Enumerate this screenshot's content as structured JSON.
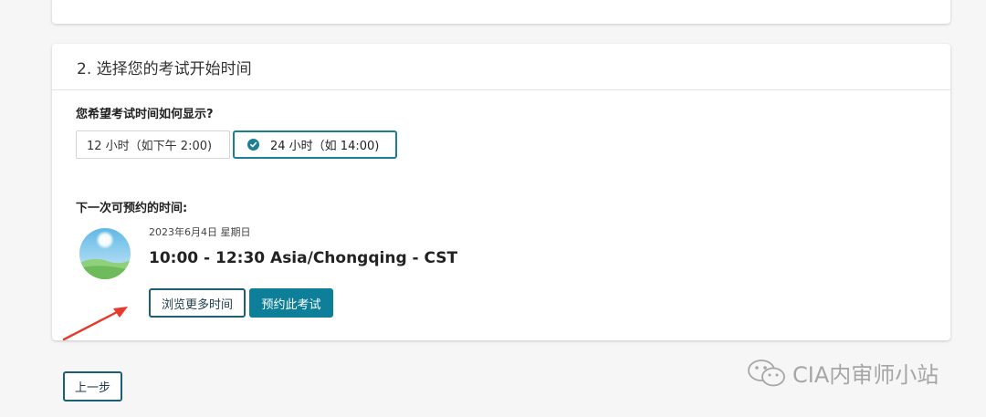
{
  "section": {
    "title": "2. 选择您的考试开始时间"
  },
  "time_format": {
    "question": "您希望考试时间如何显示?",
    "option_12h": "12 小时（如下午 2:00)",
    "option_24h": "24 小时（如 14:00)",
    "selected": "24h",
    "accent_color": "#1b7f96"
  },
  "next_slot": {
    "label": "下一次可预约的时间:",
    "date": "2023年6月4日 星期日",
    "time": "10:00 - 12:30 Asia/Chongqing - CST",
    "browse_label": "浏览更多时间",
    "book_label": "预约此考试",
    "avatar_icon": "sky-landscape-icon"
  },
  "nav": {
    "prev_label": "上一步"
  },
  "watermark": {
    "icon": "wechat-icon",
    "text": "CIA内审师小站"
  },
  "annotation": {
    "icon": "red-arrow-icon",
    "color": "#e8392c"
  }
}
